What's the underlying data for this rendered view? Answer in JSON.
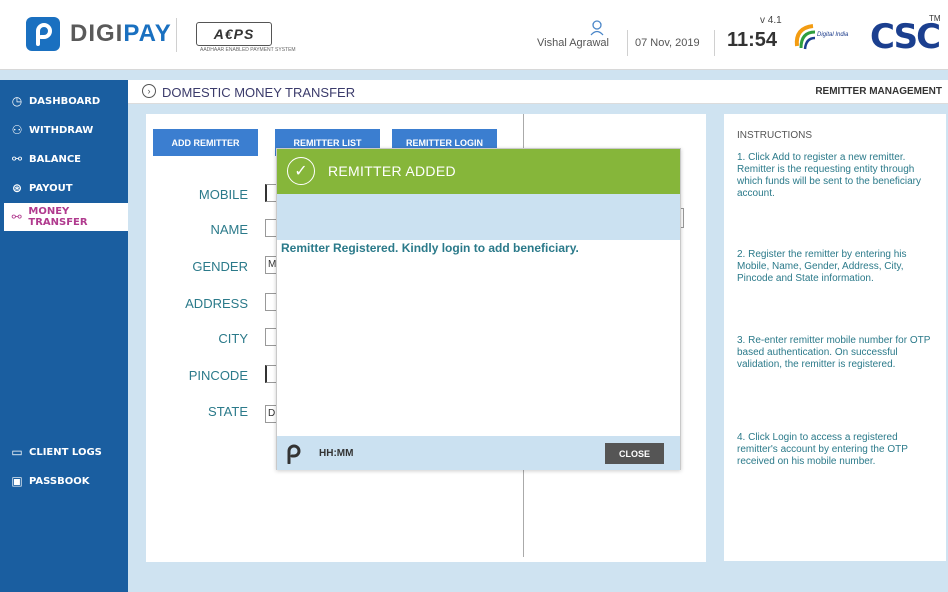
{
  "header": {
    "brand_prefix": "DIGI",
    "brand_suffix": "PAY",
    "aeps_logo": "A€PS",
    "aeps_tagline": "AADHAAR ENABLED PAYMENT SYSTEM",
    "user_name": "Vishal Agrawal",
    "date": "07 Nov, 2019",
    "version": "v 4.1",
    "time": "11:54",
    "digital_india": "Digital India",
    "csc_logo": "CSC",
    "trademark": "TM"
  },
  "sidebar": {
    "items": [
      {
        "label": "DASHBOARD",
        "icon": "dashboard-icon"
      },
      {
        "label": "WITHDRAW",
        "icon": "withdraw-icon"
      },
      {
        "label": "BALANCE",
        "icon": "balance-icon"
      },
      {
        "label": "PAYOUT",
        "icon": "payout-icon"
      },
      {
        "label": "MONEY TRANSFER",
        "icon": "money-transfer-icon"
      },
      {
        "label": "CLIENT LOGS",
        "icon": "client-logs-icon"
      },
      {
        "label": "PASSBOOK",
        "icon": "passbook-icon"
      }
    ],
    "active": "MONEY TRANSFER"
  },
  "breadcrumb": {
    "title": "DOMESTIC MONEY TRANSFER",
    "section": "REMITTER MANAGEMENT"
  },
  "tabs": {
    "add": "ADD REMITTER",
    "list": "REMITTER LIST",
    "login": "REMITTER LOGIN"
  },
  "form": {
    "labels": [
      "MOBILE",
      "NAME",
      "GENDER",
      "ADDRESS",
      "CITY",
      "PINCODE",
      "STATE"
    ],
    "gender_value": "M",
    "state_value": "D"
  },
  "instructions": {
    "title": "INSTRUCTIONS",
    "items": [
      "1. Click Add to register a new remitter. Remitter is the requesting entity through which funds will be sent to the beneficiary account.",
      "2. Register the remitter by entering his Mobile, Name, Gender, Address, City, Pincode and State information.",
      "3. Re-enter remitter mobile number for OTP based authentication. On successful validation, the remitter is registered.",
      "4. Click Login to access a registered remitter's account by entering the OTP received on his mobile number."
    ]
  },
  "modal": {
    "title": "REMITTER ADDED",
    "message": "Remitter Registered. Kindly login to add beneficiary.",
    "time_placeholder": "HH:MM",
    "close_label": "CLOSE"
  },
  "colors": {
    "primary": "#1a5ea0",
    "button": "#3b7ed0",
    "success": "#86b63a",
    "active_nav": "#b03a8e",
    "teal_text": "#2b7a8a"
  }
}
